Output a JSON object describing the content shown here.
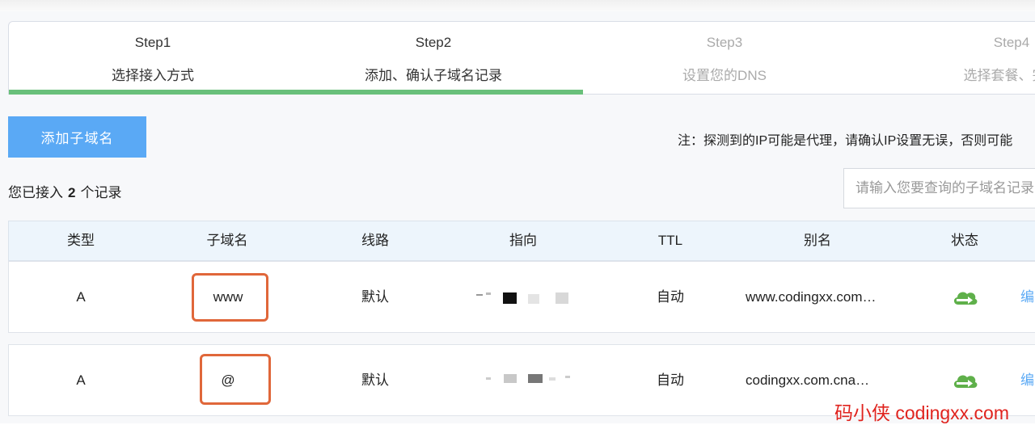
{
  "steps": [
    {
      "num": "Step1",
      "label": "选择接入方式",
      "state": "done"
    },
    {
      "num": "Step2",
      "label": "添加、确认子域名记录",
      "state": "current"
    },
    {
      "num": "Step3",
      "label": "设置您的DNS",
      "state": "pending"
    },
    {
      "num": "Step4",
      "label": "选择套餐、完成",
      "state": "pending"
    }
  ],
  "progress_color": "#69c07a",
  "toolbar": {
    "add_label": "添加子域名",
    "note": "注：探测到的IP可能是代理，请确认IP设置无误，否则可能"
  },
  "summary": {
    "prefix": "您已接入",
    "count": "2",
    "suffix": "个记录"
  },
  "search": {
    "placeholder": "请输入您要查询的子域名记录"
  },
  "table": {
    "headers": [
      "类型",
      "子域名",
      "线路",
      "指向",
      "TTL",
      "别名",
      "状态"
    ],
    "rows": [
      {
        "type": "A",
        "subdomain": "www",
        "line": "默认",
        "target": "",
        "ttl": "自动",
        "alias": "www.codingxx.com…",
        "status_icon": "cloud-icon",
        "action": "编"
      },
      {
        "type": "A",
        "subdomain": "@",
        "line": "默认",
        "target": "",
        "ttl": "自动",
        "alias": "codingxx.com.cna…",
        "status_icon": "cloud-icon",
        "action": "编"
      }
    ]
  },
  "watermark": "码小侠 codingxx.com",
  "colors": {
    "accent": "#5aa9f5",
    "highlight": "#e0673a",
    "watermark": "#e0231e"
  }
}
